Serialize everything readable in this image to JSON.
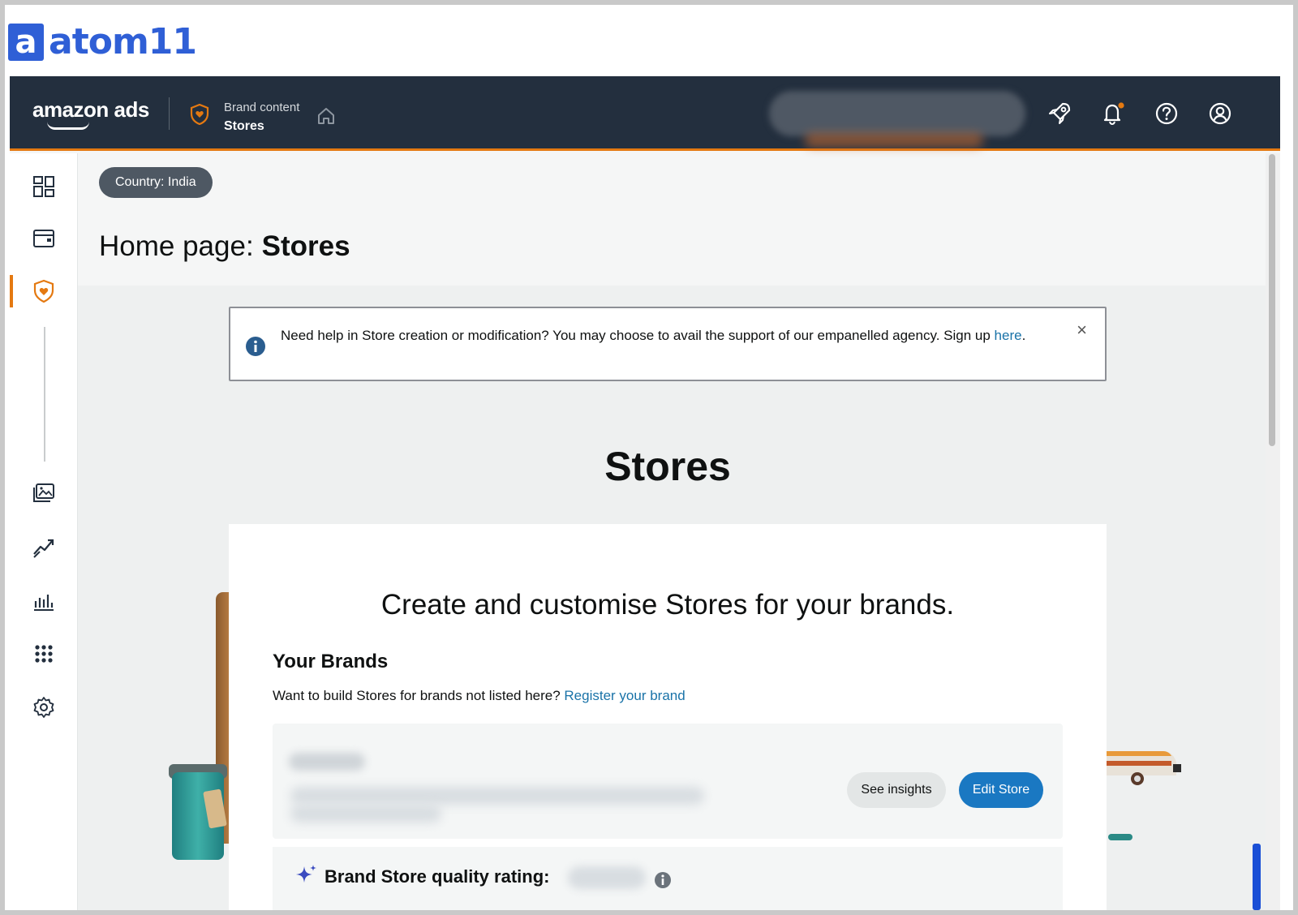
{
  "atom_logo": {
    "mark": "a",
    "text": "atom11"
  },
  "topbar": {
    "brand": "amazon ads",
    "breadcrumb_top": "Brand content",
    "breadcrumb_bottom": "Stores",
    "icons": [
      "rocket-icon",
      "bell-icon",
      "help-icon",
      "account-icon"
    ]
  },
  "sidenav": {
    "icons": [
      "dashboard-icon",
      "campaigns-icon",
      "brand-content-icon",
      "creative-assets-icon",
      "insights-icon",
      "reports-icon",
      "apps-icon",
      "settings-icon"
    ],
    "active": "brand-content-icon"
  },
  "main": {
    "country_pill": "Country: India",
    "page_title_prefix": "Home page:",
    "page_title_bold": "Stores",
    "info_banner": {
      "text": "Need help in Store creation or modification? You may choose to avail the support of our empanelled agency. Sign up ",
      "link": "here",
      "suffix": "."
    },
    "heading": "Stores",
    "card_title": "Create and customise Stores for your brands.",
    "your_brands": "Your Brands",
    "want_text": "Want to build Stores for brands not listed here? ",
    "register_link": "Register your brand",
    "see_insights": "See insights",
    "edit_store": "Edit Store",
    "rating_label": "Brand Store quality rating:"
  },
  "colors": {
    "topbar": "#232f3e",
    "accent_orange": "#e47911",
    "link_blue": "#1a73a8",
    "primary_button": "#1a78c2",
    "atom_blue": "#2f5fd6"
  }
}
